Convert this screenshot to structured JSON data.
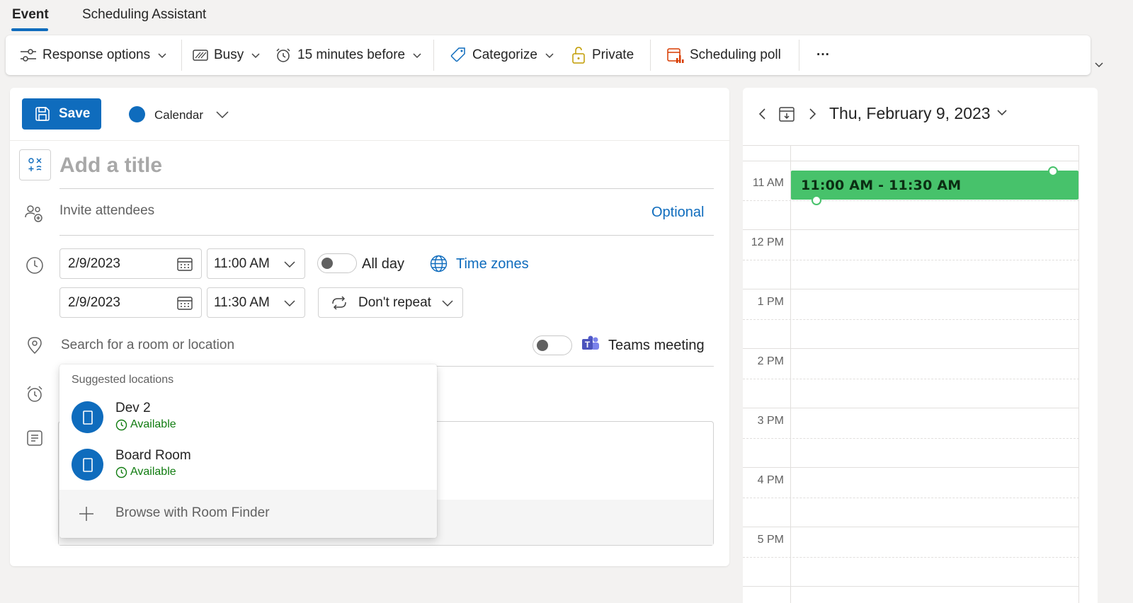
{
  "tabs": [
    {
      "label": "Event",
      "active": true
    },
    {
      "label": "Scheduling Assistant",
      "active": false
    }
  ],
  "ribbon": {
    "response_options": "Response options",
    "busy": "Busy",
    "reminder": "15 minutes before",
    "categorize": "Categorize",
    "private": "Private",
    "scheduling_poll": "Scheduling poll",
    "more": "···"
  },
  "form": {
    "save_label": "Save",
    "calendar_label": "Calendar",
    "title_placeholder": "Add a title",
    "attendees_placeholder": "Invite attendees",
    "optional_label": "Optional",
    "start_date": "2/9/2023",
    "start_time": "11:00 AM",
    "end_date": "2/9/2023",
    "end_time": "11:30 AM",
    "all_day_label": "All day",
    "time_zones_label": "Time zones",
    "repeat_label": "Don't repeat",
    "location_placeholder": "Search for a room or location",
    "teams_label": "Teams meeting"
  },
  "suggestions": {
    "header": "Suggested locations",
    "items": [
      {
        "name": "Dev 2",
        "status": "Available"
      },
      {
        "name": "Board Room",
        "status": "Available"
      }
    ],
    "footer": "Browse with Room Finder"
  },
  "calendar": {
    "date_label": "Thu, February 9, 2023",
    "hours": [
      "11 AM",
      "12 PM",
      "1 PM",
      "2 PM",
      "3 PM",
      "4 PM",
      "5 PM"
    ],
    "event_label": "11:00 AM - 11:30 AM"
  },
  "colors": {
    "accent": "#0f6cbd",
    "event": "#47c26b",
    "available": "#107c10"
  }
}
